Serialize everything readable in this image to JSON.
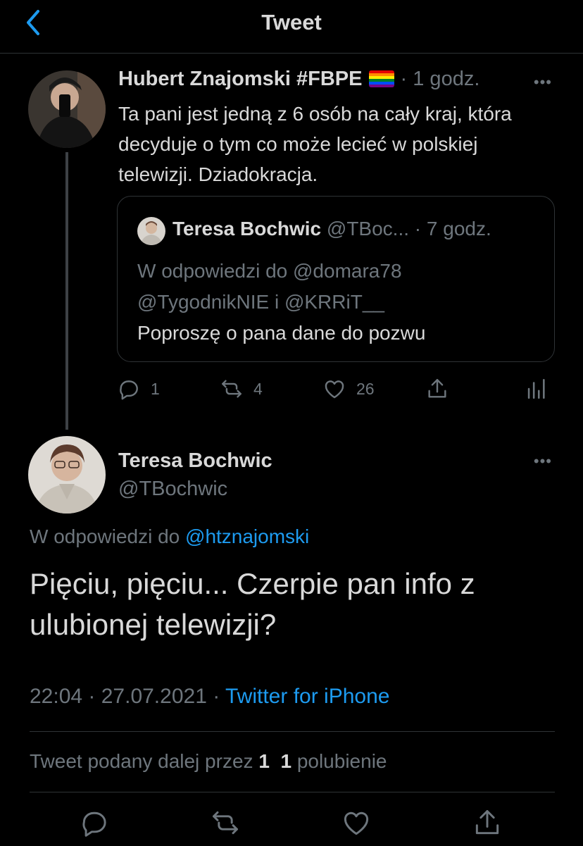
{
  "header": {
    "title": "Tweet",
    "back_icon": "chevron-left-icon",
    "accent": "#1d9bf0"
  },
  "parent_tweet": {
    "author_name": "Hubert Znajomski #FBPE",
    "time": "1 godz.",
    "text": "Ta pani jest jedną z 6 osób na cały kraj, która decyduje o tym co może lecieć w polskiej telewizji. Dziadokracja.",
    "quoted": {
      "author_name": "Teresa Bochwic",
      "handle": "@TBoc...",
      "time": "7 godz.",
      "reply_to_line1": "W odpowiedzi do @domara78",
      "reply_to_line2": "@TygodnikNIE i @KRRiT__",
      "text": "Poproszę o pana dane do pozwu"
    },
    "actions": {
      "replies": "1",
      "retweets": "4",
      "likes": "26"
    }
  },
  "main_tweet": {
    "author_name": "Teresa Bochwic",
    "handle": "@TBochwic",
    "reply_prefix": "W odpowiedzi do",
    "reply_to": "@htznajomski",
    "text": "Pięciu, pięciu... Czerpie pan info z ulubionej telewizji?",
    "time": "22:04 · 27.07.2021 ·",
    "client": "Twitter for iPhone",
    "stats": {
      "retweets_label": "Tweet podany dalej przez",
      "retweets_count": "1",
      "likes_count": "1",
      "likes_label": "polubienie"
    }
  },
  "colors": {
    "background": "#000000",
    "text": "#d9d9d9",
    "muted": "#6e767d",
    "link": "#1d9bf0",
    "border": "#2f3336"
  }
}
